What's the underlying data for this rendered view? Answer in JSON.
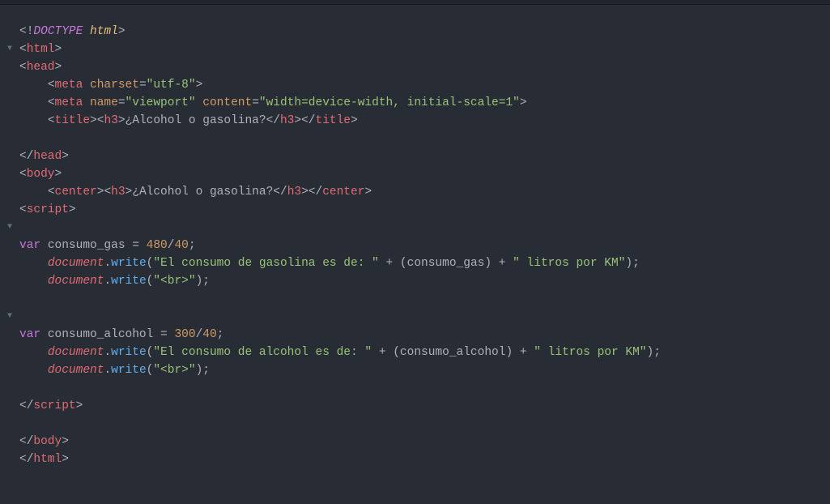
{
  "doctype_bang": "<!",
  "doctype_word": "DOCTYPE",
  "doctype_val": "html",
  "gt": ">",
  "lt": "<",
  "slash": "/",
  "eq": "=",
  "tags": {
    "html": "html",
    "head": "head",
    "meta": "meta",
    "title": "title",
    "h3": "h3",
    "body": "body",
    "center": "center",
    "script": "script"
  },
  "attrs": {
    "charset": "charset",
    "name": "name",
    "content": "content"
  },
  "strings": {
    "utf8": "\"utf-8\"",
    "viewport": "\"viewport\"",
    "content_val": "\"width=device-width, initial-scale=1\"",
    "title_text": "¿Alcohol o gasolina?",
    "gas_msg": "\"El consumo de gasolina es de: \"",
    "alc_msg": "\"El consumo de alcohol es de: \"",
    "litros": "\" litros por KM\"",
    "br": "\"<br>\""
  },
  "kw": {
    "var": "var"
  },
  "obj": {
    "document": "document"
  },
  "funcs": {
    "write": "write"
  },
  "vars": {
    "consumo_gas": "consumo_gas",
    "consumo_alcohol": "consumo_alcohol"
  },
  "nums": {
    "n480": "480",
    "n40a": "40",
    "n300": "300",
    "n40b": "40"
  },
  "arrows": {
    "down": "▼"
  }
}
